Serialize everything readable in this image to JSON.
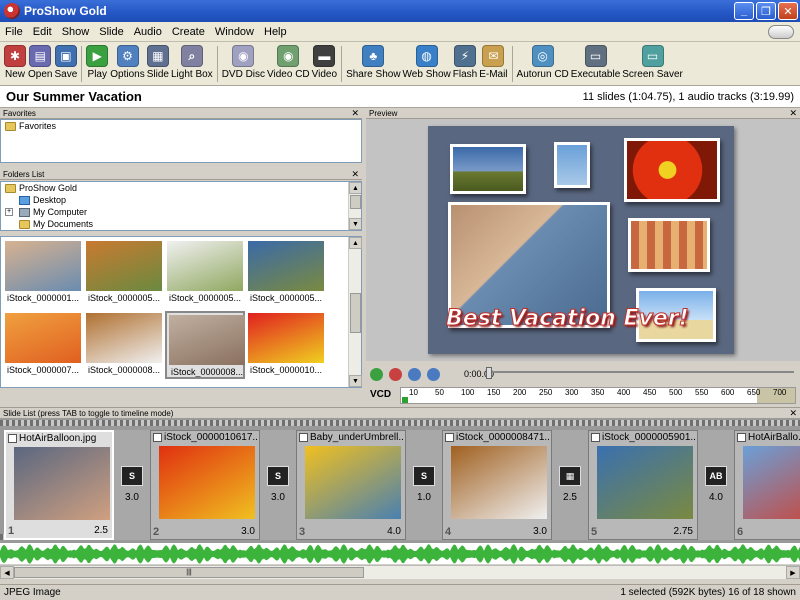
{
  "window": {
    "title": "ProShow Gold"
  },
  "menu": [
    "File",
    "Edit",
    "Show",
    "Slide",
    "Audio",
    "Create",
    "Window",
    "Help"
  ],
  "toolbar": [
    {
      "label": "New",
      "color": "#c04040",
      "glyph": "✱"
    },
    {
      "label": "Open",
      "color": "#6a6ab0",
      "glyph": "▤"
    },
    {
      "label": "Save",
      "color": "#4070b0",
      "glyph": "▣"
    },
    {
      "label": "Play",
      "color": "#3aa040",
      "glyph": "▶"
    },
    {
      "label": "Options",
      "color": "#5080c0",
      "glyph": "⚙"
    },
    {
      "label": "Slide",
      "color": "#607090",
      "glyph": "▦"
    },
    {
      "label": "Light Box",
      "color": "#8080a0",
      "glyph": "⌕"
    },
    {
      "label": "DVD Disc",
      "color": "#a0a0c0",
      "glyph": "◉"
    },
    {
      "label": "Video CD",
      "color": "#70a070",
      "glyph": "◉"
    },
    {
      "label": "Video",
      "color": "#404040",
      "glyph": "▬"
    },
    {
      "label": "Share Show",
      "color": "#4080c0",
      "glyph": "♣"
    },
    {
      "label": "Web Show",
      "color": "#3a80c8",
      "glyph": "◍"
    },
    {
      "label": "Flash",
      "color": "#507090",
      "glyph": "⚡"
    },
    {
      "label": "E-Mail",
      "color": "#c8a050",
      "glyph": "✉"
    },
    {
      "label": "Autorun CD",
      "color": "#5090c0",
      "glyph": "◎"
    },
    {
      "label": "Executable",
      "color": "#607080",
      "glyph": "▭"
    },
    {
      "label": "Screen Saver",
      "color": "#50a0a0",
      "glyph": "▭"
    }
  ],
  "show": {
    "title": "Our Summer Vacation",
    "info": "11 slides (1:04.75), 1 audio tracks (3:19.99)"
  },
  "panels": {
    "favorites": "Favorites",
    "folders": "Folders List",
    "preview": "Preview",
    "slide_list": "Slide List (press TAB to toggle to timeline mode)"
  },
  "favorites_items": [
    "Favorites"
  ],
  "folders_items": [
    {
      "label": "ProShow Gold",
      "icon": "folder-icon"
    },
    {
      "label": "Desktop",
      "icon": "desktop-icon"
    },
    {
      "label": "My Computer",
      "icon": "computer-icon"
    },
    {
      "label": "My Documents",
      "icon": "folder-icon"
    }
  ],
  "thumbnails": [
    {
      "caption": "iStock_0000001...",
      "c1": "#d7b290",
      "c2": "#6a8cb0"
    },
    {
      "caption": "iStock_0000005...",
      "c1": "#c87a30",
      "c2": "#6a8a40"
    },
    {
      "caption": "iStock_0000005...",
      "c1": "#f0f0f0",
      "c2": "#90a860"
    },
    {
      "caption": "iStock_0000005...",
      "c1": "#3a6aa8",
      "c2": "#7a8a40"
    },
    {
      "caption": "iStock_0000007...",
      "c1": "#f0a040",
      "c2": "#e06020"
    },
    {
      "caption": "iStock_0000008...",
      "c1": "#b07030",
      "c2": "#f0f0f0"
    },
    {
      "caption": "iStock_0000008...",
      "c1": "#c0b0a0",
      "c2": "#8a7060"
    },
    {
      "caption": "iStock_0000010...",
      "c1": "#e02020",
      "c2": "#f0d020"
    }
  ],
  "preview": {
    "caption": "Best Vacation Ever!",
    "time": "0:00.00"
  },
  "timeline": {
    "label": "VCD",
    "ticks": [
      "10",
      "50",
      "100",
      "150",
      "200",
      "250",
      "300",
      "350",
      "400",
      "450",
      "500",
      "550",
      "600",
      "650",
      "700"
    ]
  },
  "slides": [
    {
      "name": "HotAirBalloon.jpg",
      "num": "1",
      "dur": "2.5",
      "c1": "#5a6780",
      "c2": "#d0a080"
    },
    {
      "name": "iStock_0000010617...",
      "num": "2",
      "dur": "3.0",
      "c1": "#e03010",
      "c2": "#f0c020"
    },
    {
      "name": "Baby_underUmbrell...",
      "num": "3",
      "dur": "4.0",
      "c1": "#f0c020",
      "c2": "#4a80b0"
    },
    {
      "name": "iStock_0000008471...",
      "num": "4",
      "dur": "3.0",
      "c1": "#a06020",
      "c2": "#f0f0f0"
    },
    {
      "name": "iStock_0000005901...",
      "num": "5",
      "dur": "2.75",
      "c1": "#3a70b0",
      "c2": "#7a8a40"
    },
    {
      "name": "HotAirBallo...",
      "num": "6",
      "dur": "",
      "c1": "#6aa0d8",
      "c2": "#d04030"
    }
  ],
  "transitions": [
    {
      "dur": "3.0",
      "glyph": "S"
    },
    {
      "dur": "3.0",
      "glyph": "S"
    },
    {
      "dur": "1.0",
      "glyph": "S"
    },
    {
      "dur": "2.5",
      "glyph": "▦"
    },
    {
      "dur": "4.0",
      "glyph": "AB"
    }
  ],
  "status": {
    "left": "JPEG Image",
    "right": "1 selected (592K bytes) 16 of 18 shown"
  }
}
